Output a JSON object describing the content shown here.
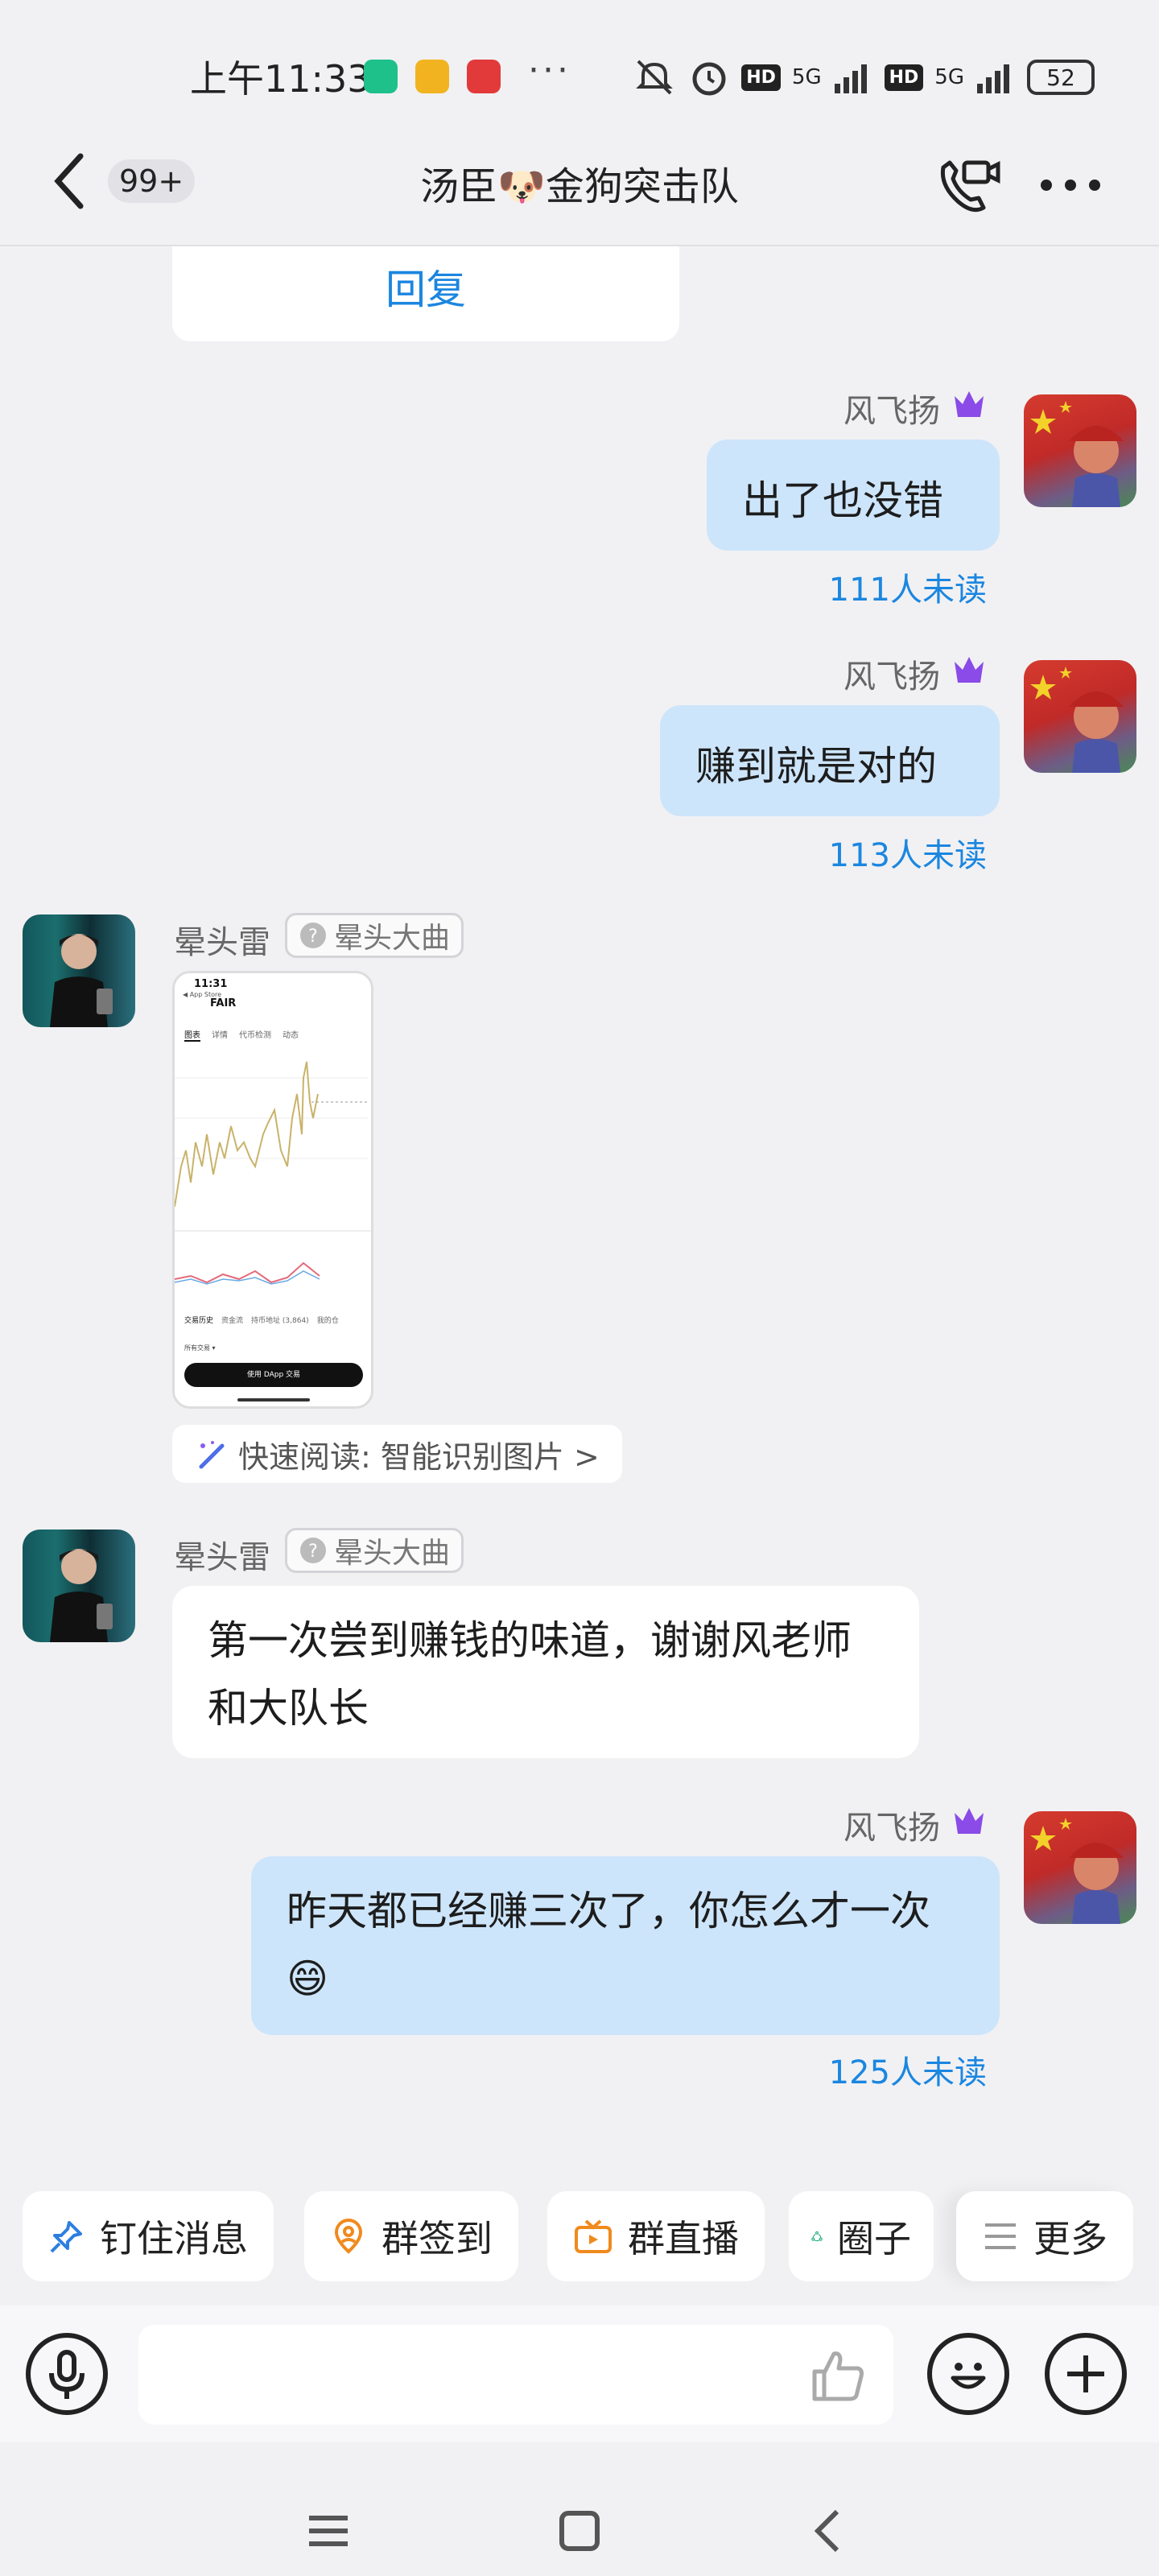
{
  "status": {
    "time": "上午11:33",
    "dots": "···",
    "network1": "5G",
    "network2": "5G",
    "hd": "HD",
    "battery": "52"
  },
  "header": {
    "badge": "99+",
    "title": "汤臣🐶金狗突击队"
  },
  "messages": {
    "reply_label": "回复",
    "m1": {
      "sender": "风飞扬",
      "text": "出了也没错",
      "unread": "111人未读"
    },
    "m2": {
      "sender": "风飞扬",
      "text": "赚到就是对的",
      "unread": "113人未读"
    },
    "m3": {
      "sender": "晕头雷",
      "tag": "晕头大曲",
      "quick_read": "快速阅读: 智能识别图片 >"
    },
    "m4": {
      "sender": "晕头雷",
      "tag": "晕头大曲",
      "text": "第一次尝到赚钱的味道，谢谢风老师和大队长"
    },
    "m5": {
      "sender": "风飞扬",
      "text": "昨天都已经赚三次了，你怎么才一次😄",
      "unread": "125人未读"
    }
  },
  "screenshot": {
    "time": "11:31",
    "store": "◀ App Store",
    "token": "FAIR",
    "tabs": [
      "图表",
      "详情",
      "代币检测",
      "动态"
    ],
    "bottom_tabs": [
      "交易历史",
      "资金流",
      "持币地址 (3,864)",
      "我的仓"
    ],
    "filter": "所有交易 ▾",
    "button": "使用 DApp 交易"
  },
  "quickbar": {
    "pin": "钉住消息",
    "checkin": "群签到",
    "live": "群直播",
    "circle": "圈子",
    "more": "更多"
  },
  "colors": {
    "accent": "#1b86e0",
    "bubble_me": "#cde5fb",
    "vip": "#8a4be8"
  }
}
